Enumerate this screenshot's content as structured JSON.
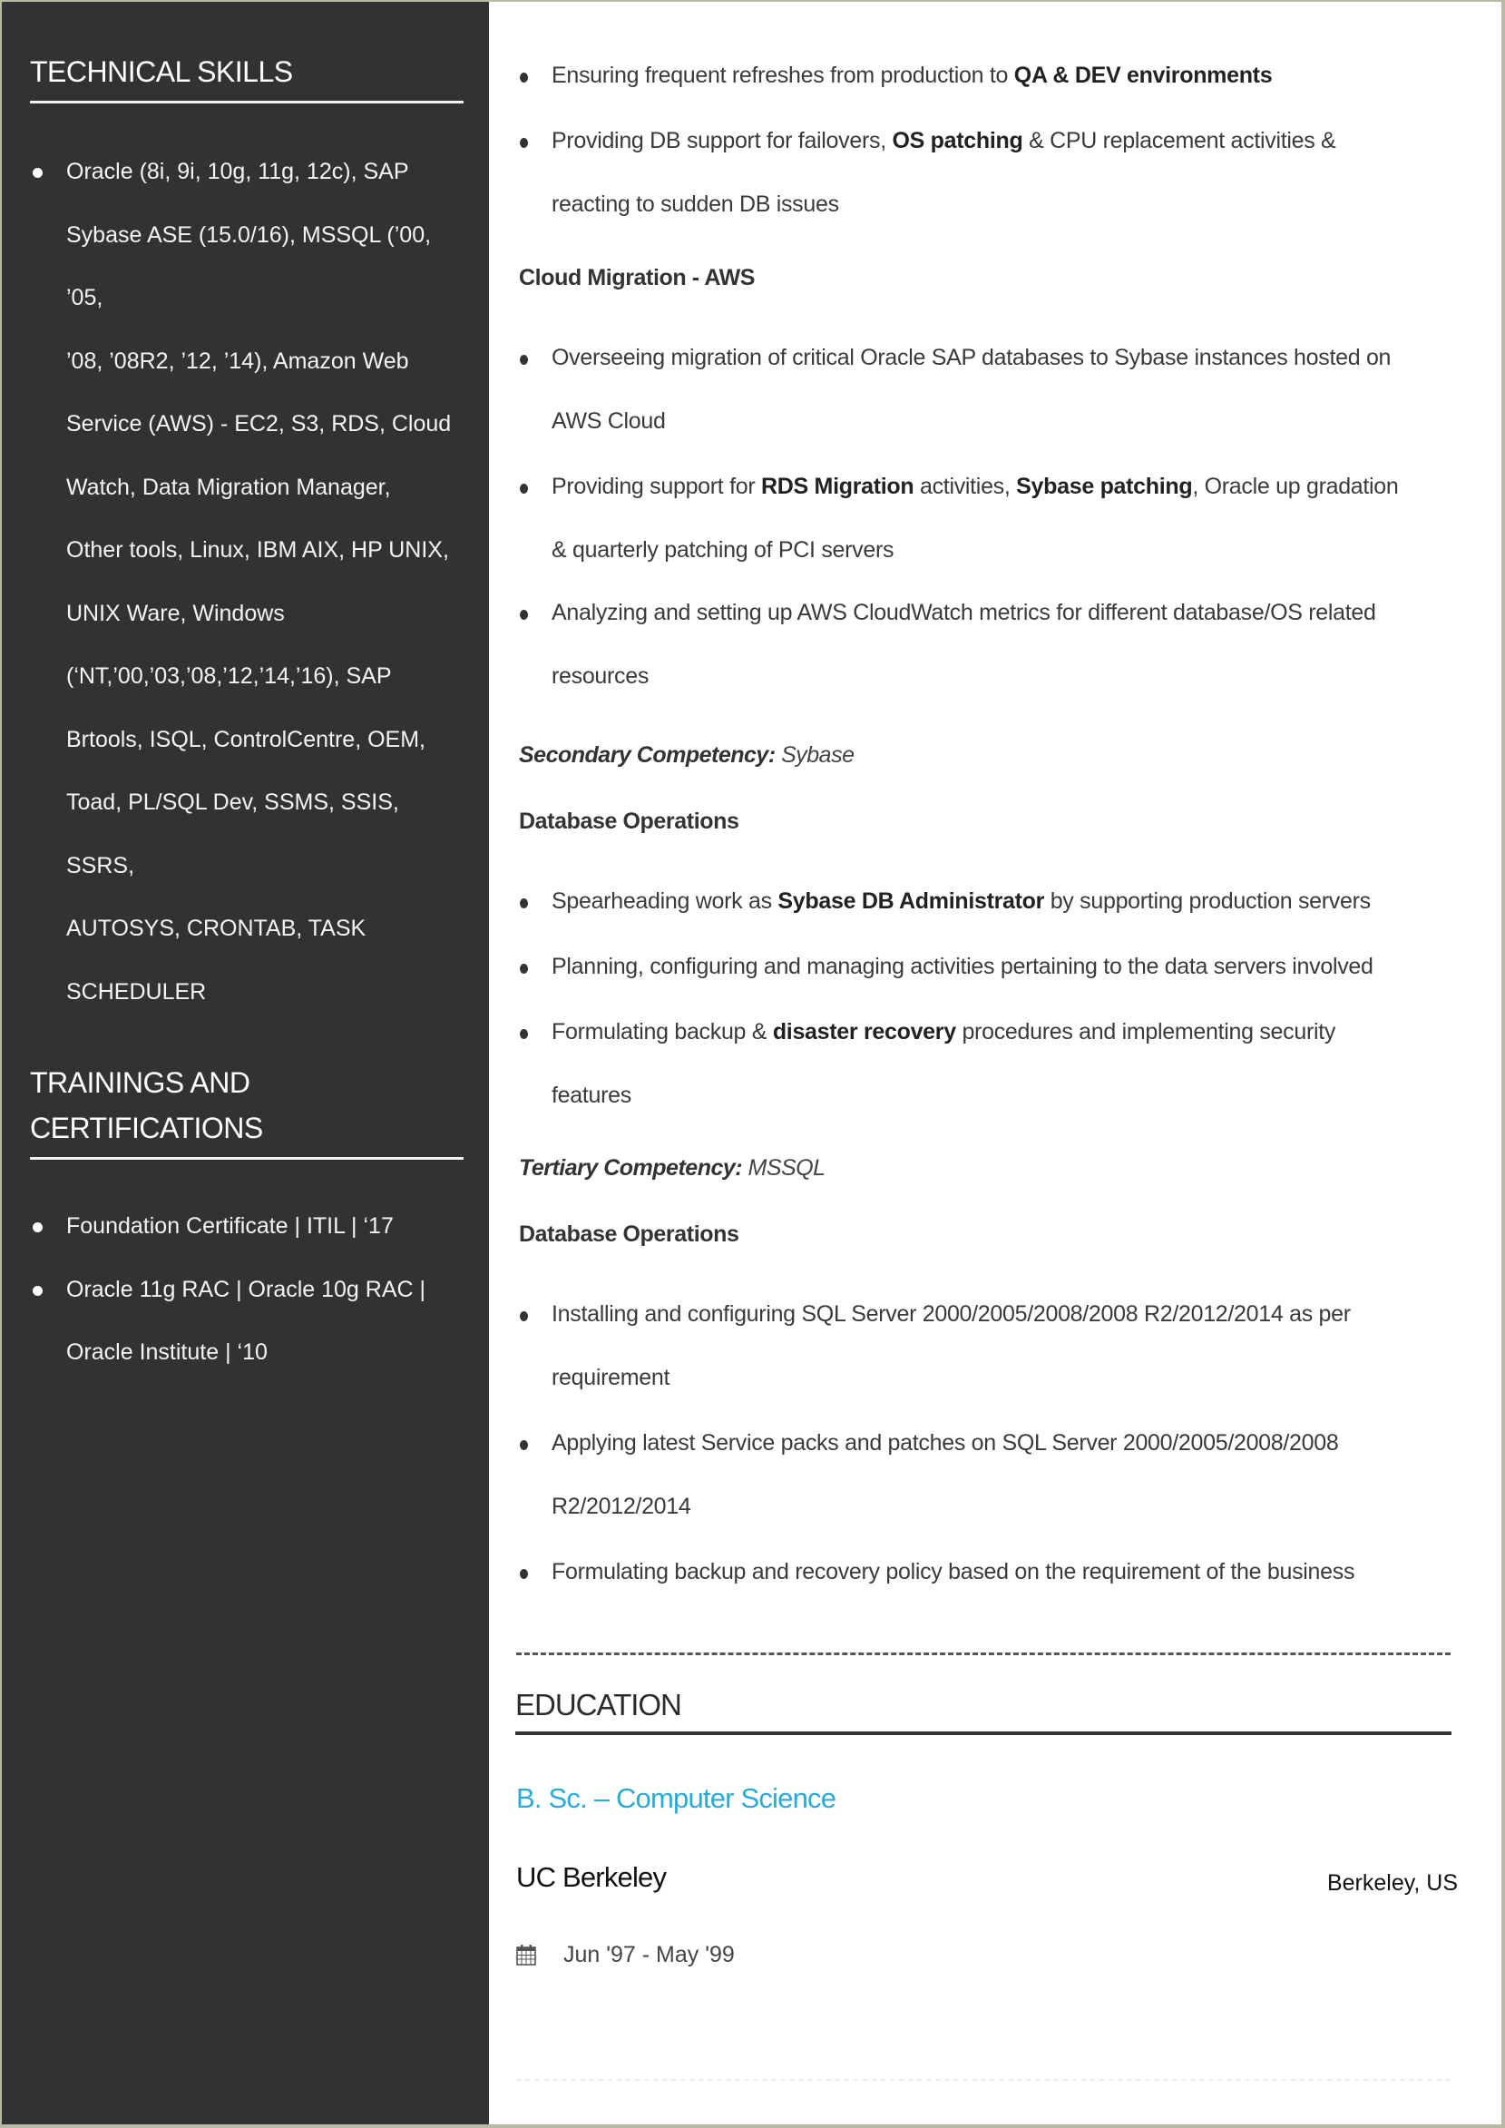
{
  "sidebar": {
    "technical_skills": {
      "heading": "TECHNICAL SKILLS",
      "items": [
        {
          "lines": [
            "Oracle (8i, 9i, 10g, 11g, 12c), SAP",
            "Sybase ASE (15.0/16), MSSQL (’00, ’05,",
            "’08, ’08R2, ’12, ’14), Amazon Web",
            "Service (AWS) - EC2, S3, RDS, Cloud",
            "Watch, Data Migration Manager,",
            "Other tools, Linux, IBM AIX, HP UNIX,",
            "UNIX Ware, Windows",
            "(‘NT,’00,’03,’08,’12,’14,’16), SAP",
            "Brtools, ISQL, ControlCentre, OEM,",
            "Toad, PL/SQL Dev, SSMS, SSIS, SSRS,",
            "AUTOSYS, CRONTAB, TASK",
            "SCHEDULER"
          ]
        }
      ]
    },
    "trainings": {
      "heading_line1": "TRAININGS AND",
      "heading_line2": "CERTIFICATIONS",
      "items": [
        {
          "lines": [
            "Foundation Certificate  | ITIL | ‘17"
          ]
        },
        {
          "lines": [
            "Oracle 11g RAC | Oracle 10g RAC |",
            "Oracle Institute | ‘10"
          ]
        }
      ]
    }
  },
  "main": {
    "primary_bullets": [
      {
        "parts": [
          [
            "Ensuring frequent refreshes from production to ",
            false
          ],
          [
            "QA & DEV environments",
            true
          ]
        ]
      },
      {
        "line1": [
          [
            "Providing DB support for failovers, ",
            false
          ],
          [
            "OS patching",
            true
          ],
          [
            " & CPU replacement activities &",
            false
          ]
        ],
        "line2": "reacting to sudden DB issues"
      }
    ],
    "cloud_migration": {
      "heading": "Cloud Migration - AWS",
      "bullets": [
        {
          "line1": [
            [
              "Overseeing migration of critical Oracle SAP databases to Sybase instances hosted on",
              false
            ]
          ],
          "line2": "AWS Cloud"
        },
        {
          "line1": [
            [
              "Providing support for ",
              false
            ],
            [
              "RDS Migration",
              true
            ],
            [
              " activities, ",
              false
            ],
            [
              "Sybase patching",
              true
            ],
            [
              ", Oracle up gradation",
              false
            ]
          ],
          "line2": "& quarterly patching of PCI servers"
        },
        {
          "line1": [
            [
              "Analyzing and setting up AWS CloudWatch metrics for different database/OS related",
              false
            ]
          ],
          "line2": "resources"
        }
      ]
    },
    "secondary": {
      "label": "Secondary Competency:",
      "value": "Sybase",
      "subheading": "Database Operations",
      "bullets": [
        {
          "line1": [
            [
              "Spearheading work as ",
              false
            ],
            [
              "Sybase DB Administrator",
              true
            ],
            [
              " by supporting production servers",
              false
            ]
          ]
        },
        {
          "line1": [
            [
              "Planning, configuring and managing activities pertaining to the data servers involved",
              false
            ]
          ]
        },
        {
          "line1": [
            [
              "Formulating backup & ",
              false
            ],
            [
              "disaster recovery",
              true
            ],
            [
              " procedures and implementing security",
              false
            ]
          ],
          "line2": "features"
        }
      ]
    },
    "tertiary": {
      "label": "Tertiary Competency:",
      "value": "MSSQL",
      "subheading": "Database Operations",
      "bullets": [
        {
          "line1": [
            [
              "Installing and configuring SQL Server 2000/2005/2008/2008 R2/2012/2014 as per",
              false
            ]
          ],
          "line2": "requirement"
        },
        {
          "line1": [
            [
              "Applying latest Service packs and patches on SQL Server 2000/2005/2008/2008",
              false
            ]
          ],
          "line2": "R2/2012/2014"
        },
        {
          "line1": [
            [
              "Formulating backup and recovery policy based on the requirement of the business",
              false
            ]
          ]
        }
      ]
    },
    "education": {
      "heading": "EDUCATION",
      "degree": "B. Sc. – Computer Science",
      "school": "UC Berkeley",
      "location": "Berkeley, US",
      "dates": "Jun '97 -  May '99",
      "date_icon": "calendar-icon"
    }
  },
  "colors": {
    "sidebar_bg": "#323232",
    "accent": "#29abd9",
    "frame": "#b9b9a6"
  }
}
